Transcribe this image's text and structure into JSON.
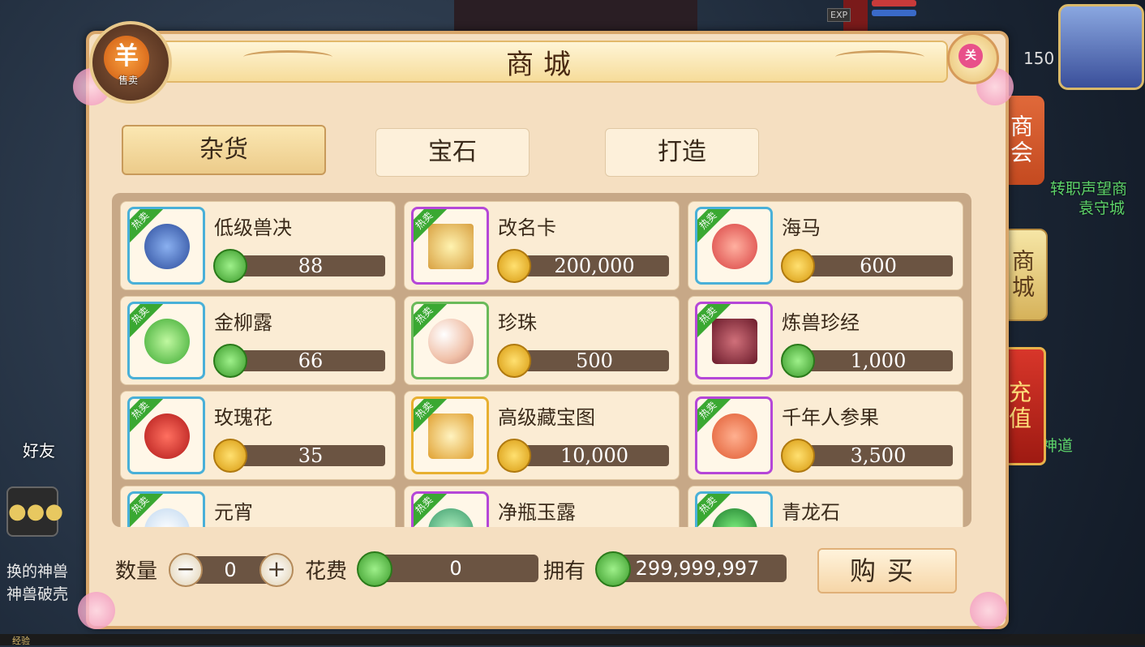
{
  "window": {
    "title": "商城"
  },
  "sell_button": {
    "label": "售卖",
    "glyph": "羊"
  },
  "close_button": {
    "label": "关"
  },
  "hud": {
    "exp_tag": "EXP",
    "hero_level": "150",
    "right_text1": "转职声望商",
    "right_text2": "袁守城",
    "right_text3": "神道",
    "friends_label": "好友",
    "chat_line1": "换的神兽",
    "chat_line2": "神兽破壳",
    "exp_bottom": "经验"
  },
  "side_tabs": [
    {
      "label": "商会"
    },
    {
      "label": "商城"
    },
    {
      "label": "充值"
    }
  ],
  "categories": [
    {
      "label": "杂货",
      "selected": true
    },
    {
      "label": "宝石",
      "selected": false
    },
    {
      "label": "打造",
      "selected": false
    }
  ],
  "items": [
    {
      "name": "低级兽决",
      "price": "88",
      "currency": "jade",
      "hot": "热卖",
      "frame": "blue",
      "icon": "book-icon"
    },
    {
      "name": "改名卡",
      "price": "200,000",
      "currency": "gold",
      "hot": "热卖",
      "frame": "purple",
      "icon": "scroll-card-icon"
    },
    {
      "name": "海马",
      "price": "600",
      "currency": "gold",
      "hot": "热卖",
      "frame": "blue",
      "icon": "seahorse-icon"
    },
    {
      "name": "金柳露",
      "price": "66",
      "currency": "jade",
      "hot": "热卖",
      "frame": "blue",
      "icon": "gourd-icon"
    },
    {
      "name": "珍珠",
      "price": "500",
      "currency": "gold",
      "hot": "热卖",
      "frame": "green",
      "icon": "pearl-icon"
    },
    {
      "name": "炼兽珍经",
      "price": "1,000",
      "currency": "jade",
      "hot": "热卖",
      "frame": "purple",
      "icon": "tome-icon"
    },
    {
      "name": "玫瑰花",
      "price": "35",
      "currency": "gold",
      "hot": "热卖",
      "frame": "blue",
      "icon": "rose-icon"
    },
    {
      "name": "高级藏宝图",
      "price": "10,000",
      "currency": "gold",
      "hot": "热卖",
      "frame": "gold",
      "icon": "treasure-map-icon"
    },
    {
      "name": "千年人参果",
      "price": "3,500",
      "currency": "gold",
      "hot": "热卖",
      "frame": "purple",
      "icon": "ginseng-fruit-icon"
    },
    {
      "name": "元宵",
      "price": "",
      "currency": "gold",
      "hot": "热卖",
      "frame": "blue",
      "icon": "dumpling-icon"
    },
    {
      "name": "净瓶玉露",
      "price": "",
      "currency": "gold",
      "hot": "热卖",
      "frame": "purple",
      "icon": "vase-icon"
    },
    {
      "name": "青龙石",
      "price": "",
      "currency": "gold",
      "hot": "热卖",
      "frame": "blue",
      "icon": "dragon-stone-icon"
    }
  ],
  "purchase": {
    "qty_label": "数量",
    "qty_value": "0",
    "minus": "−",
    "plus": "+",
    "cost_label": "花费",
    "cost_value": "0",
    "own_label": "拥有",
    "own_value": "299,999,997",
    "buy_label": "购买"
  },
  "colors": {
    "panel_bg": "#f5dfc1",
    "hot_badge": "#3aa832",
    "price_bar": "#6b5442",
    "frame_blue": "#49b0d8",
    "frame_purple": "#b547d8",
    "frame_green": "#6aba5a",
    "frame_gold": "#e8b030"
  }
}
